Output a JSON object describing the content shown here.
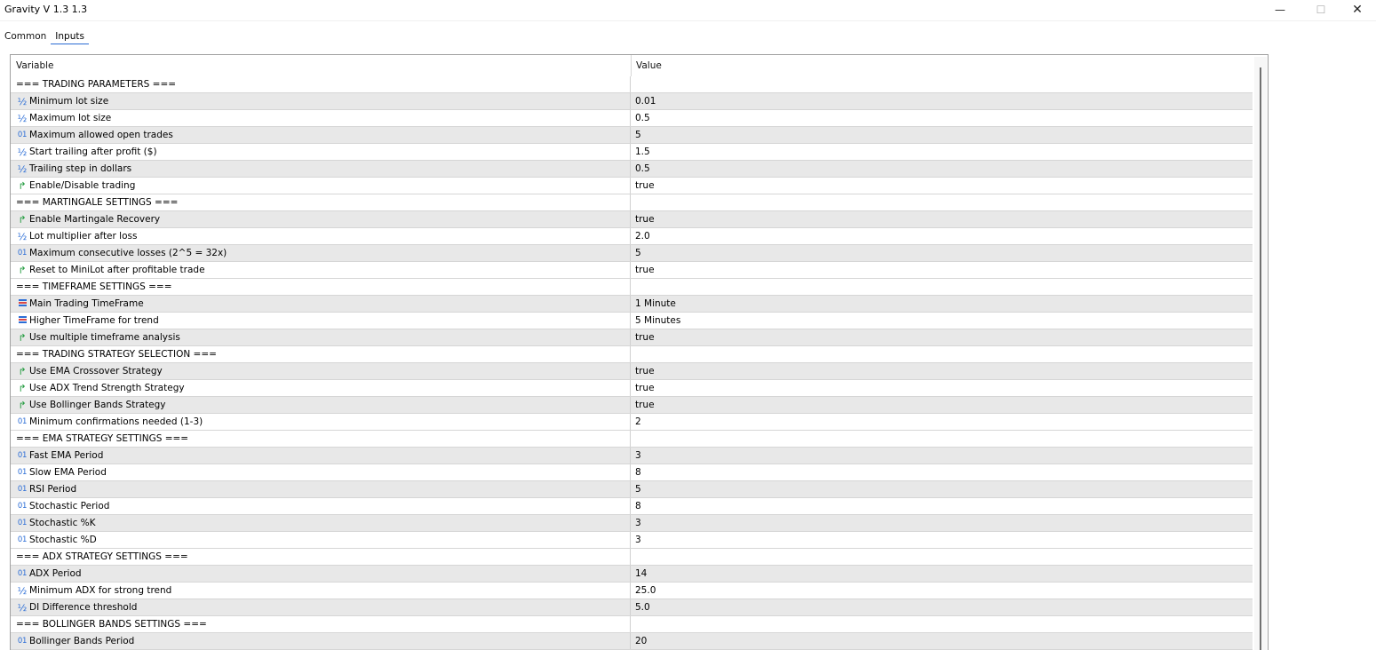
{
  "window": {
    "title": "Gravity V 1.3  1.3",
    "min_glyph": "—",
    "max_glyph": "☐",
    "close_glyph": "✕"
  },
  "tabs": [
    {
      "label": "Common",
      "active": false
    },
    {
      "label": "Inputs",
      "active": true
    }
  ],
  "grid": {
    "header_variable": "Variable",
    "header_value": "Value"
  },
  "type_icons": {
    "double": "½",
    "int": "01",
    "bool": "↱"
  },
  "rows": [
    {
      "type": "section",
      "name": "=== TRADING PARAMETERS ===",
      "value": ""
    },
    {
      "type": "double",
      "name": "Minimum lot size",
      "value": "0.01"
    },
    {
      "type": "double",
      "name": "Maximum lot size",
      "value": "0.5"
    },
    {
      "type": "int",
      "name": "Maximum allowed open trades",
      "value": "5"
    },
    {
      "type": "double",
      "name": "Start trailing after profit ($)",
      "value": "1.5"
    },
    {
      "type": "double",
      "name": "Trailing step in dollars",
      "value": "0.5"
    },
    {
      "type": "bool",
      "name": "Enable/Disable trading",
      "value": "true"
    },
    {
      "type": "section",
      "name": "=== MARTINGALE SETTINGS ===",
      "value": ""
    },
    {
      "type": "bool",
      "name": "Enable Martingale Recovery",
      "value": "true"
    },
    {
      "type": "double",
      "name": "Lot multiplier after loss",
      "value": "2.0"
    },
    {
      "type": "int",
      "name": "Maximum consecutive losses (2^5 = 32x)",
      "value": "5"
    },
    {
      "type": "bool",
      "name": "Reset to MiniLot after profitable trade",
      "value": "true"
    },
    {
      "type": "section",
      "name": "=== TIMEFRAME SETTINGS ===",
      "value": ""
    },
    {
      "type": "enum",
      "name": "Main Trading TimeFrame",
      "value": "1 Minute"
    },
    {
      "type": "enum",
      "name": "Higher TimeFrame for trend",
      "value": "5 Minutes"
    },
    {
      "type": "bool",
      "name": "Use multiple timeframe analysis",
      "value": "true"
    },
    {
      "type": "section",
      "name": "=== TRADING STRATEGY SELECTION ===",
      "value": ""
    },
    {
      "type": "bool",
      "name": "Use EMA Crossover Strategy",
      "value": "true"
    },
    {
      "type": "bool",
      "name": "Use ADX Trend Strength Strategy",
      "value": "true"
    },
    {
      "type": "bool",
      "name": "Use Bollinger Bands Strategy",
      "value": "true"
    },
    {
      "type": "int",
      "name": "Minimum confirmations needed (1-3)",
      "value": "2"
    },
    {
      "type": "section",
      "name": "=== EMA STRATEGY SETTINGS ===",
      "value": ""
    },
    {
      "type": "int",
      "name": "Fast EMA Period",
      "value": "3"
    },
    {
      "type": "int",
      "name": "Slow EMA Period",
      "value": "8"
    },
    {
      "type": "int",
      "name": "RSI Period",
      "value": "5"
    },
    {
      "type": "int",
      "name": "Stochastic Period",
      "value": "8"
    },
    {
      "type": "int",
      "name": "Stochastic %K",
      "value": "3"
    },
    {
      "type": "int",
      "name": "Stochastic %D",
      "value": "3"
    },
    {
      "type": "section",
      "name": "=== ADX STRATEGY SETTINGS ===",
      "value": ""
    },
    {
      "type": "int",
      "name": "ADX Period",
      "value": "14"
    },
    {
      "type": "double",
      "name": "Minimum ADX for strong trend",
      "value": "25.0"
    },
    {
      "type": "double",
      "name": "DI Difference threshold",
      "value": "5.0"
    },
    {
      "type": "section",
      "name": "=== BOLLINGER BANDS SETTINGS ===",
      "value": ""
    },
    {
      "type": "int",
      "name": "Bollinger Bands Period",
      "value": "20"
    }
  ]
}
